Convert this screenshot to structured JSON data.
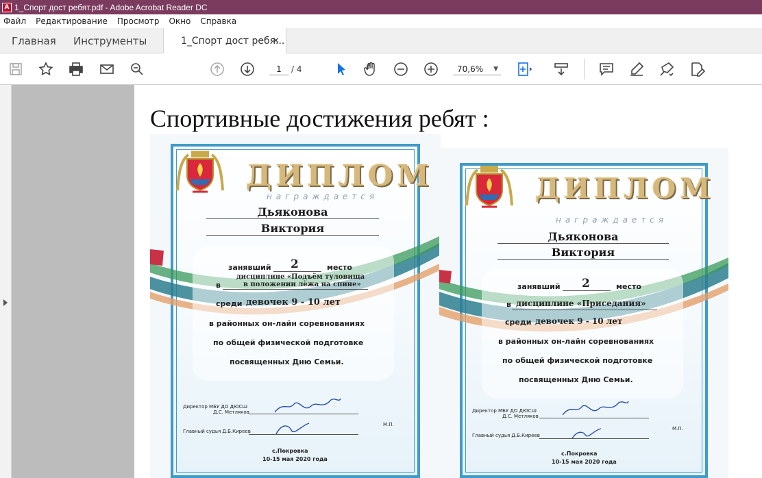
{
  "window": {
    "title": "1_Спорт дост ребят.pdf - Adobe Acrobat Reader DC",
    "app_icon_letter": "A"
  },
  "menu": [
    "Файл",
    "Редактирование",
    "Просмотр",
    "Окно",
    "Справка"
  ],
  "tabs": {
    "home": "Главная",
    "tools": "Инструменты",
    "document": "1_Спорт дост ребя...",
    "close": "×"
  },
  "toolbar": {
    "page_current": "1",
    "page_total": "/ 4",
    "zoom": "70,6%",
    "zoom_arrow": "▼"
  },
  "document": {
    "heading": "Спортивные достижения ребят :",
    "diplomas": [
      {
        "title": "ДИПЛОМ",
        "awarded": "награждается",
        "surname": "Дьяконова",
        "first_name": "Виктория",
        "place_label": "занявший",
        "place_value": "2",
        "place_suffix": "место",
        "in_label": "в",
        "discipline_line1": "дисциплине «Подъём туловища",
        "discipline_line2": "в положении лёжа на спине»",
        "among_label": "среди",
        "among_value": "девочек 9 - 10 лет",
        "line1": "в районных он-лайн соревнованиях",
        "line2": "по общей физической подготовке",
        "line3": "посвященных Дню Семьи.",
        "director": "Директор  МБУ ДО ДЮСШ",
        "director_name": "Д.С. Метляков",
        "judge": "Главный судья   Д.Б.Киреев",
        "stamp": "М.П.",
        "city": "с.Покровка",
        "date": "10-15 мая 2020 года"
      },
      {
        "title": "ДИПЛОМ",
        "awarded": "награждается",
        "surname": "Дьяконова",
        "first_name": "Виктория",
        "place_label": "занявший",
        "place_value": "2",
        "place_suffix": "место",
        "in_label": "в",
        "discipline_line1": "дисциплине «Приседания»",
        "among_label": "среди",
        "among_value": "девочек  9 - 10 лет",
        "line1": "в районных он-лайн соревнованиях",
        "line2": "по общей физической подготовке",
        "line3": "посвященных Дню Семьи.",
        "director": "Директор  МБУ ДО ДЮСШ",
        "director_name": "Д.С. Метляков",
        "judge": "Главный судья   Д.Б.Киреев",
        "stamp": "М.П.",
        "city": "с.Покровка",
        "date": "10-15 мая 2020 года"
      }
    ]
  },
  "colors": {
    "titlebar": "#7a3b5e",
    "accent_blue": "#1473e6",
    "frame_blue": "#3f9bc8",
    "gold": "#d6b87c"
  },
  "icons": [
    "save-icon",
    "bookmark-star-icon",
    "print-icon",
    "email-icon",
    "search-zoom-icon",
    "page-up-icon",
    "page-down-icon",
    "select-cursor-icon",
    "hand-icon",
    "zoom-out-icon",
    "zoom-in-icon",
    "fit-page-icon",
    "read-mode-icon",
    "comment-icon",
    "highlight-pen-icon",
    "sign-icon",
    "fill-sign-icon"
  ]
}
